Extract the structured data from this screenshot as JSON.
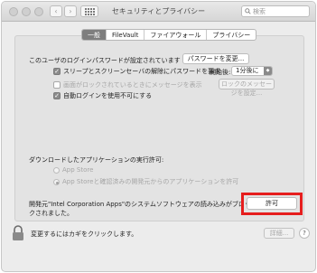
{
  "window": {
    "title": "セキュリティとプライバシー"
  },
  "search": {
    "placeholder": "検索"
  },
  "tabs": [
    {
      "label": "一般",
      "active": true
    },
    {
      "label": "FileVault",
      "active": false
    },
    {
      "label": "ファイアウォール",
      "active": false
    },
    {
      "label": "プライバシー",
      "active": false
    }
  ],
  "general": {
    "login_password_text": "このユーザのログインパスワードが設定されています",
    "change_password_button": "パスワードを変更...",
    "require_password_label": "スリープとスクリーンセーバの解除にパスワードを要求",
    "start_label": "開始後:",
    "start_value": "1分後に",
    "show_message_label": "画面がロックされているときにメッセージを表示",
    "set_lock_message_button": "ロックのメッセージを設定...",
    "disable_auto_login_label": "自動ログインを使用不可にする",
    "allow_apps_heading": "ダウンロードしたアプリケーションの実行許可:",
    "option_app_store": "App Store",
    "option_app_store_identified": "App Storeと確認済みの開発元からのアプリケーションを許可",
    "blocked_message_line1": "開発元\"Intel Corporation Apps\"のシステムソフトウェアの読み込みがブロッ",
    "blocked_message_line2": "クされました。",
    "allow_button": "許可"
  },
  "footer": {
    "lock_text": "変更するにはカギをクリックします。",
    "advanced_button": "詳細...",
    "help_button": "?"
  }
}
